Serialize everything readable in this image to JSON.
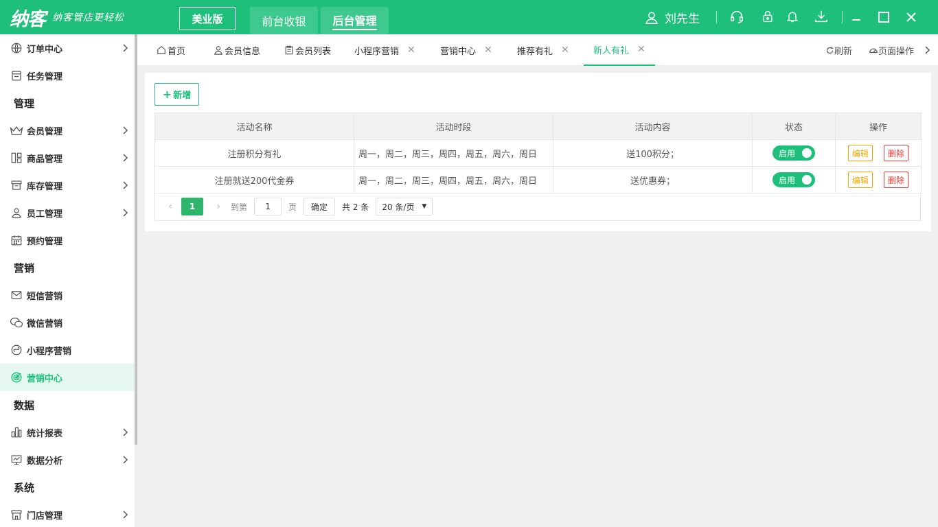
{
  "topbar": {
    "logo_main": "纳客",
    "logo_sub": "纳客管店更轻松",
    "edition": "美业版",
    "modes": [
      "前台收银",
      "后台管理"
    ],
    "user_name": "刘先生",
    "icons": [
      "headset-icon",
      "lock-icon",
      "bell-icon",
      "download-icon"
    ],
    "window": [
      "minimize-icon",
      "maximize-icon",
      "close-icon"
    ]
  },
  "sidebar": {
    "items": [
      {
        "type": "item",
        "label": "订单中心",
        "icon": "globe-icon",
        "arrow": true
      },
      {
        "type": "item",
        "label": "任务管理",
        "icon": "task-icon",
        "arrow": false
      },
      {
        "type": "section",
        "label": "管理"
      },
      {
        "type": "item",
        "label": "会员管理",
        "icon": "crown-icon",
        "arrow": true
      },
      {
        "type": "item",
        "label": "商品管理",
        "icon": "goods-icon",
        "arrow": true
      },
      {
        "type": "item",
        "label": "库存管理",
        "icon": "inventory-icon",
        "arrow": true
      },
      {
        "type": "item",
        "label": "员工管理",
        "icon": "person-icon",
        "arrow": true
      },
      {
        "type": "item",
        "label": "预约管理",
        "icon": "calendar-icon",
        "arrow": false
      },
      {
        "type": "section",
        "label": "营销"
      },
      {
        "type": "item",
        "label": "短信营销",
        "icon": "mail-icon",
        "arrow": false
      },
      {
        "type": "item",
        "label": "微信营销",
        "icon": "wechat-icon",
        "arrow": false
      },
      {
        "type": "item",
        "label": "小程序营销",
        "icon": "miniprogram-icon",
        "arrow": false
      },
      {
        "type": "item",
        "label": "营销中心",
        "icon": "target-icon",
        "arrow": false,
        "active": true
      },
      {
        "type": "section",
        "label": "数据"
      },
      {
        "type": "item",
        "label": "统计报表",
        "icon": "bar-chart-icon",
        "arrow": true
      },
      {
        "type": "item",
        "label": "数据分析",
        "icon": "analysis-icon",
        "arrow": true
      },
      {
        "type": "section",
        "label": "系统"
      },
      {
        "type": "item",
        "label": "门店管理",
        "icon": "store-icon",
        "arrow": true
      }
    ]
  },
  "tabs": {
    "items": [
      {
        "label": "首页",
        "icon": "home-icon",
        "closable": false
      },
      {
        "label": "会员信息",
        "icon": "user-icon",
        "closable": false
      },
      {
        "label": "会员列表",
        "icon": "clipboard-icon",
        "closable": false
      },
      {
        "label": "小程序营销",
        "closable": true
      },
      {
        "label": "营销中心",
        "closable": true
      },
      {
        "label": "推荐有礼",
        "closable": true
      },
      {
        "label": "新人有礼",
        "closable": true,
        "active": true
      }
    ],
    "refresh": "刷新",
    "page_ops": "页面操作"
  },
  "main": {
    "add_label": "新增",
    "columns": [
      "活动名称",
      "活动时段",
      "活动内容",
      "状态",
      "操作"
    ],
    "rows": [
      {
        "name": "注册积分有礼",
        "period": "周一，周二，周三，周四，周五，周六，周日",
        "content": "送100积分；",
        "status": "启用",
        "edit": "编辑",
        "delete": "删除"
      },
      {
        "name": "注册就送200代金券",
        "period": "周一，周二，周三，周四，周五，周六，周日",
        "content": "送优惠券；",
        "status": "启用",
        "edit": "编辑",
        "delete": "删除"
      }
    ],
    "pager": {
      "current": "1",
      "goto_label": "到第",
      "goto_value": "1",
      "page_label": "页",
      "confirm": "确定",
      "total": "共 2 条",
      "page_size": "20 条/页"
    }
  },
  "colors": {
    "brand": "#1dbf7a",
    "edit": "#f0a800",
    "delete": "#e53935"
  }
}
